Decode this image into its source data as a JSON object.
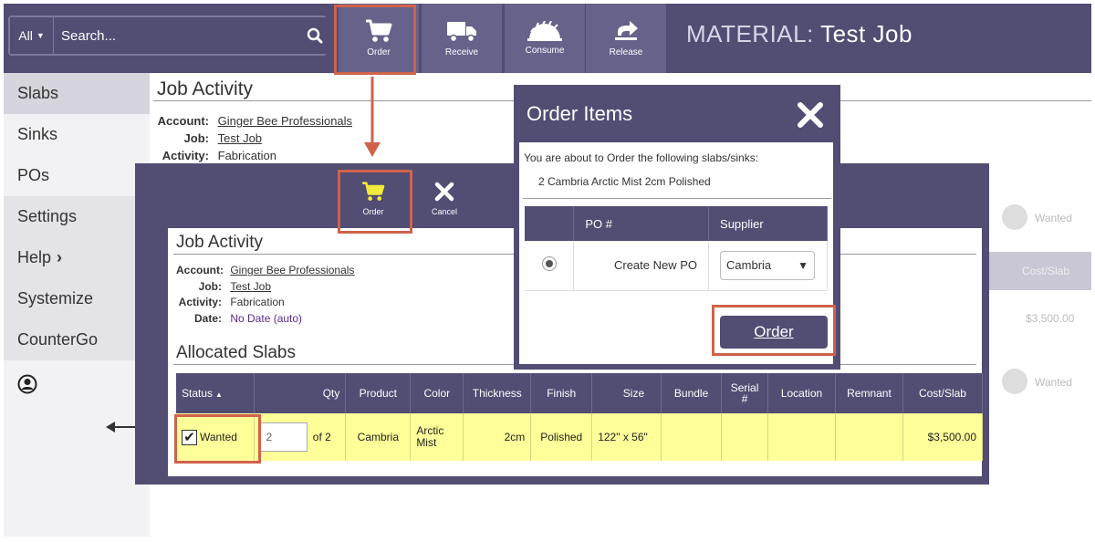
{
  "search": {
    "scope": "All",
    "placeholder": "Search..."
  },
  "toolbar": {
    "order_label": "Order",
    "receive_label": "Receive",
    "consume_label": "Consume",
    "release_label": "Release"
  },
  "header": {
    "prefix": "MATERIAL:",
    "job_name": "Test Job"
  },
  "sidebar": {
    "items": [
      {
        "label": "Slabs"
      },
      {
        "label": "Sinks"
      },
      {
        "label": "POs"
      },
      {
        "label": "Settings"
      },
      {
        "label": "Help"
      },
      {
        "label": "Systemize"
      },
      {
        "label": "CounterGo"
      }
    ]
  },
  "job_activity": {
    "title": "Job Activity",
    "account_label": "Account:",
    "account": "Ginger Bee Professionals",
    "job_label": "Job:",
    "job": "Test Job",
    "activity_label": "Activity:",
    "activity": "Fabrication",
    "date_label": "Date:",
    "date": "No Date (auto)"
  },
  "panel_toolbar": {
    "order_label": "Order",
    "cancel_label": "Cancel"
  },
  "allocated": {
    "title": "Allocated Slabs",
    "columns": [
      "Status",
      "Qty",
      "Product",
      "Color",
      "Thickness",
      "Finish",
      "Size",
      "Bundle",
      "Serial #",
      "Location",
      "Remnant",
      "Cost/Slab"
    ],
    "row": {
      "status": "Wanted",
      "qty_value": "2",
      "qty_of": "of 2",
      "product": "Cambria",
      "color": "Arctic Mist",
      "thickness": "2cm",
      "finish": "Polished",
      "size": "122\" x 56\"",
      "bundle": "",
      "serial": "",
      "location": "",
      "remnant": "",
      "cost": "$3,500.00"
    }
  },
  "dialog": {
    "title": "Order Items",
    "intro": "You are about to Order the following slabs/sinks:",
    "item": "2 Cambria Arctic Mist 2cm Polished",
    "col_po": "PO #",
    "col_supplier": "Supplier",
    "po_option": "Create New PO",
    "supplier_selected": "Cambria",
    "order_button": "Order"
  },
  "faded": {
    "label_a": "Wanted",
    "label_b": "Cost/Slab",
    "value": "$3,500.00"
  },
  "colors": {
    "primary": "#514d73",
    "highlight": "#d0624b",
    "row_yellow": "#ffff99",
    "cart_yellow": "#f2ea3a"
  }
}
